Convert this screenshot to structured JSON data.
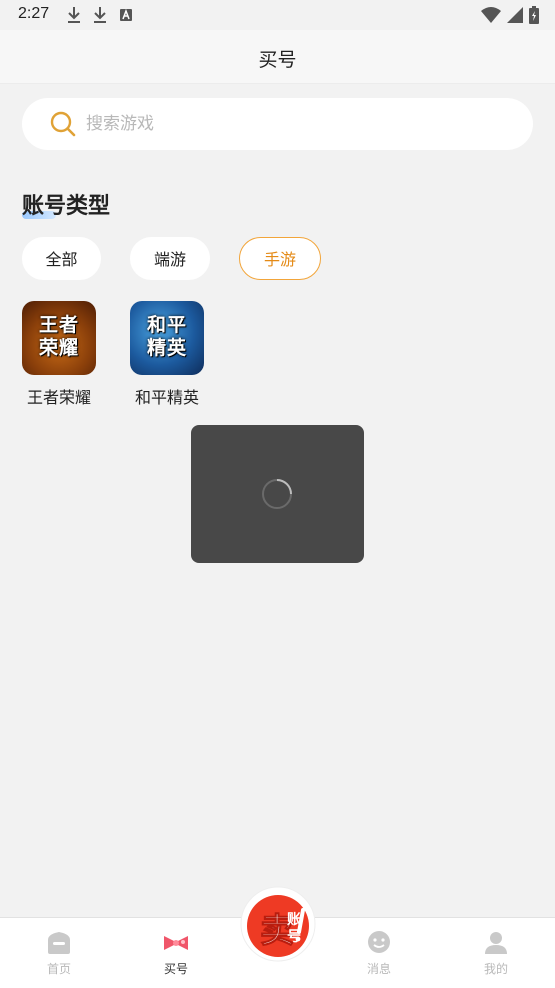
{
  "status_bar": {
    "time": "2:27"
  },
  "header": {
    "title": "买号"
  },
  "search": {
    "placeholder": "搜索游戏",
    "value": ""
  },
  "section": {
    "title": "账号类型"
  },
  "filters": [
    {
      "label": "全部",
      "active": false
    },
    {
      "label": "端游",
      "active": false
    },
    {
      "label": "手游",
      "active": true
    }
  ],
  "games": [
    {
      "name": "王者荣耀",
      "icon_text_line1": "王者",
      "icon_text_line2": "荣耀"
    },
    {
      "name": "和平精英",
      "icon_text_line1": "和平",
      "icon_text_line2": "精英"
    }
  ],
  "tabbar": {
    "items": [
      {
        "label": "首页",
        "icon": "home-icon",
        "active": false
      },
      {
        "label": "买号",
        "icon": "bow-icon",
        "active": true
      },
      {
        "label": "消息",
        "icon": "message-icon",
        "active": false
      },
      {
        "label": "我的",
        "icon": "profile-icon",
        "active": false
      }
    ],
    "center_button": {
      "icon": "sell-account-icon",
      "text_main": "卖",
      "text_sub1": "账",
      "text_sub2": "号"
    }
  },
  "colors": {
    "accent": "#e48a16",
    "background": "#f2f2f2",
    "loading_overlay": "#484848"
  }
}
